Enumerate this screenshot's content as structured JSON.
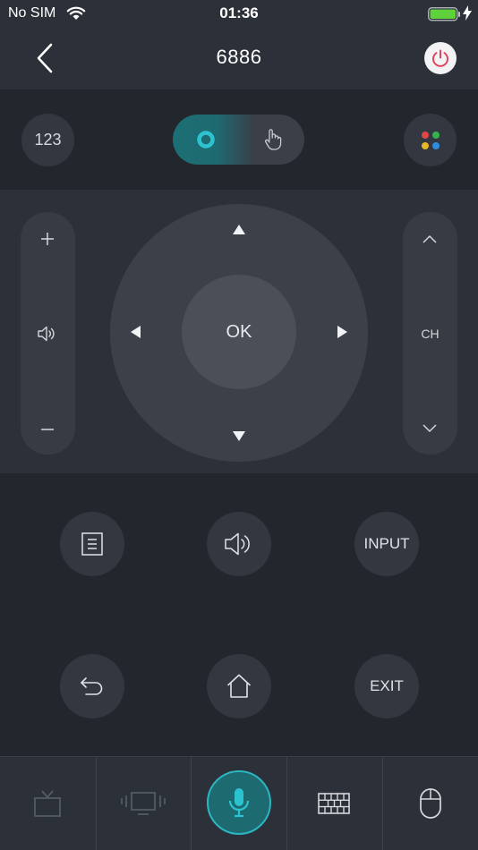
{
  "status_bar": {
    "carrier": "No SIM",
    "time": "01:36",
    "battery_color": "#5ed13b"
  },
  "header": {
    "title": "6886",
    "power_color": "#e0455f"
  },
  "mode_row": {
    "keypad_label": "123",
    "toggle_active_color": "#2bb6c1",
    "apps_dot_colors": [
      "#e14545",
      "#35b24e",
      "#e6b62b",
      "#2d8de0"
    ]
  },
  "remote": {
    "ok_label": "OK",
    "channel_label": "CH"
  },
  "buttons": {
    "input_label": "INPUT",
    "exit_label": "EXIT"
  },
  "tab_bar": {
    "items": [
      {
        "icon": "tv-icon",
        "active": false
      },
      {
        "icon": "screen-mirror-icon",
        "active": false
      },
      {
        "icon": "microphone-icon",
        "active": true
      },
      {
        "icon": "keyboard-icon",
        "active": false
      },
      {
        "icon": "mouse-icon",
        "active": false
      }
    ],
    "accent": "#2bb6c1"
  }
}
